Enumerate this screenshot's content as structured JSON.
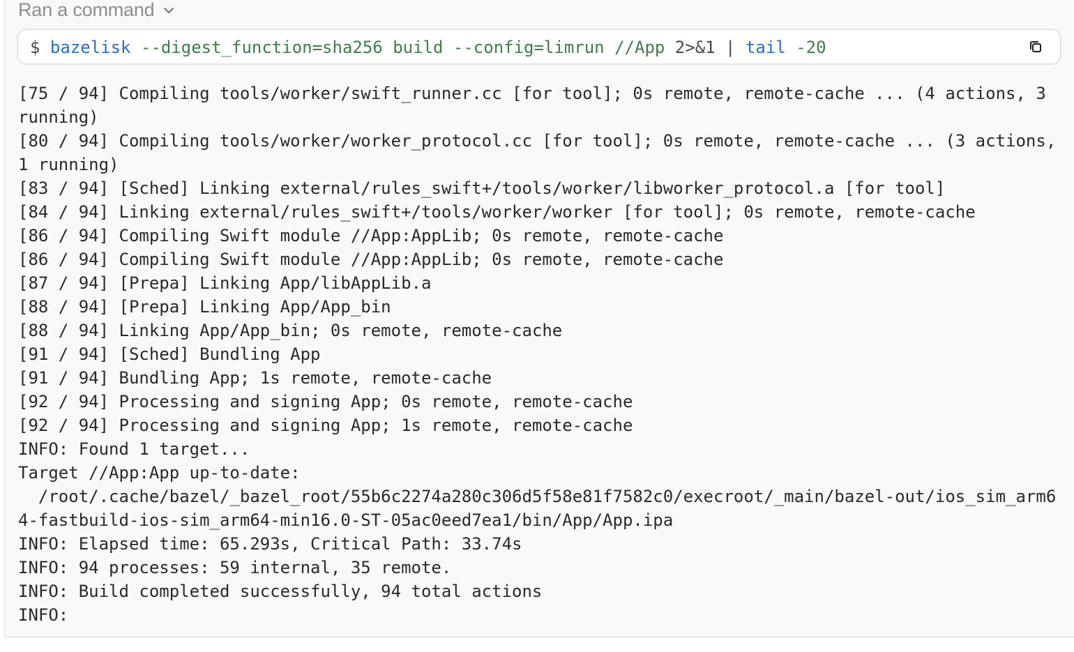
{
  "header": {
    "label": "Ran a command",
    "chevron_icon": "chevron-down-icon"
  },
  "command": {
    "prompt": "$",
    "tokens": [
      {
        "text": "bazelisk",
        "kind": "cmd"
      },
      {
        "text": "--digest_function=sha256",
        "kind": "arg"
      },
      {
        "text": "build",
        "kind": "arg"
      },
      {
        "text": "--config=limrun",
        "kind": "arg"
      },
      {
        "text": "//App",
        "kind": "arg"
      },
      {
        "text": "2>&1",
        "kind": "plain"
      },
      {
        "text": "|",
        "kind": "plain"
      },
      {
        "text": "tail",
        "kind": "cmd"
      },
      {
        "text": "-20",
        "kind": "arg"
      }
    ],
    "copy_icon": "copy-icon"
  },
  "colors": {
    "cmd": "#2b6ec8",
    "arg": "#3c7f4a",
    "plain": "#4a4a48",
    "background": "#f9f9f8"
  },
  "output": {
    "lines": [
      "[75 / 94] Compiling tools/worker/swift_runner.cc [for tool]; 0s remote, remote-cache ... (4 actions, 3",
      "running)",
      "[80 / 94] Compiling tools/worker/worker_protocol.cc [for tool]; 0s remote, remote-cache ... (3 actions,",
      "1 running)",
      "[83 / 94] [Sched] Linking external/rules_swift+/tools/worker/libworker_protocol.a [for tool]",
      "[84 / 94] Linking external/rules_swift+/tools/worker/worker [for tool]; 0s remote, remote-cache",
      "[86 / 94] Compiling Swift module //App:AppLib; 0s remote, remote-cache",
      "[86 / 94] Compiling Swift module //App:AppLib; 0s remote, remote-cache",
      "[87 / 94] [Prepa] Linking App/libAppLib.a",
      "[88 / 94] [Prepa] Linking App/App_bin",
      "[88 / 94] Linking App/App_bin; 0s remote, remote-cache",
      "[91 / 94] [Sched] Bundling App",
      "[91 / 94] Bundling App; 1s remote, remote-cache",
      "[92 / 94] Processing and signing App; 0s remote, remote-cache",
      "[92 / 94] Processing and signing App; 1s remote, remote-cache",
      "INFO: Found 1 target...",
      "Target //App:App up-to-date:",
      "  /root/.cache/bazel/_bazel_root/55b6c2274a280c306d5f58e81f7582c0/execroot/_main/bazel-out/ios_sim_arm6",
      "4-fastbuild-ios-sim_arm64-min16.0-ST-05ac0eed7ea1/bin/App/App.ipa",
      "INFO: Elapsed time: 65.293s, Critical Path: 33.74s",
      "INFO: 94 processes: 59 internal, 35 remote.",
      "INFO: Build completed successfully, 94 total actions",
      "INFO:"
    ]
  }
}
